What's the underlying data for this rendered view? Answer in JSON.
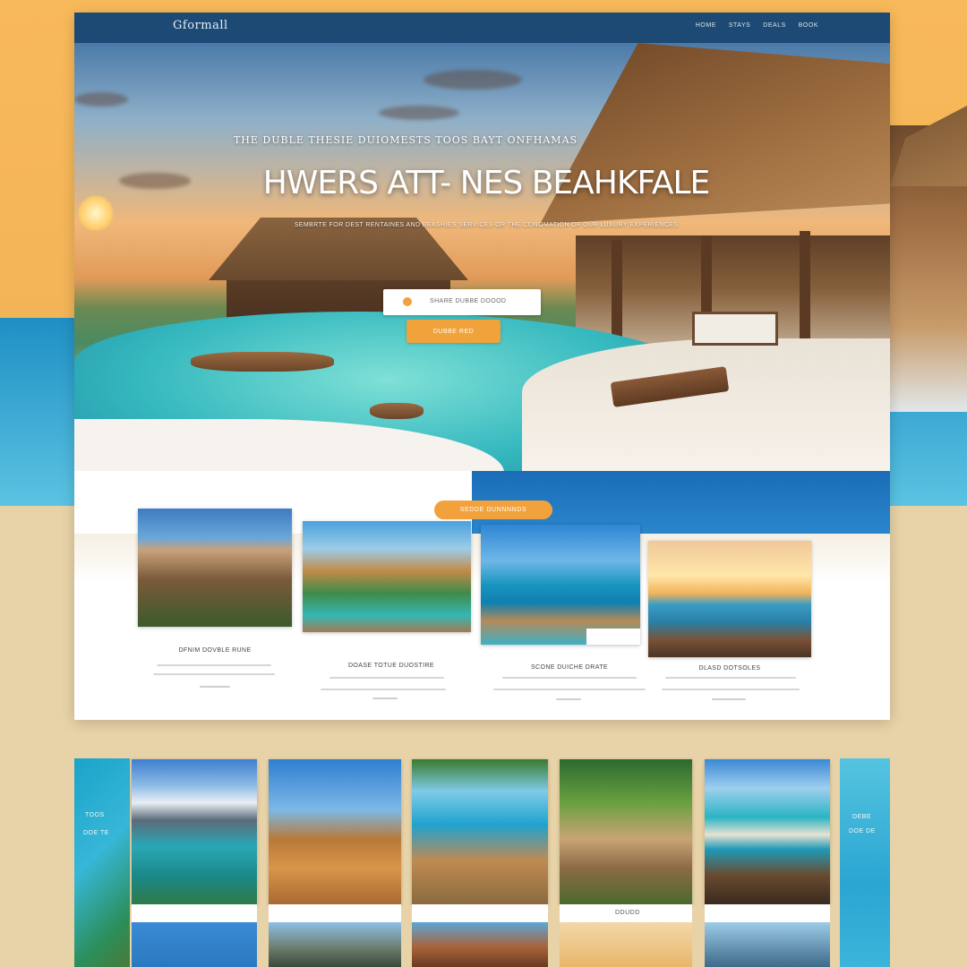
{
  "header": {
    "logo": "Gformall",
    "nav": [
      "HOME",
      "STAYS",
      "DEALS",
      "BOOK"
    ]
  },
  "hero": {
    "kicker": "THE DUBLE THESIE DUIOMESTS TOOS  BAYT ONFHAMAS",
    "title": "HWERS ATT- NES BEAHKFALE",
    "subtitle": "SEMBRTE FOR DEST RENTAINES AND BEASHIES SERVICES OR THE CONOMATION OF OUR LUXURY EXPERIENCES",
    "search_placeholder": "SHARE DUBBE DOOOD",
    "cta_label": "DUBBE RED"
  },
  "featured": {
    "pill_label": "SEDDE  DUNNNNDS",
    "cards": [
      {
        "title": "DFNIM DOVBLE RUNE"
      },
      {
        "title": "DOASE TOTUE DUOSTIRE"
      },
      {
        "title": "SCONE DUICHE DRATE"
      },
      {
        "title": "DLASD DOTSOLES"
      }
    ]
  },
  "gallery": {
    "left_label_1": "TOOS",
    "left_label_2": "DOE TE",
    "right_label_1": "DEBE",
    "right_label_2": "DOE DE",
    "caption": "DDUDD"
  },
  "colors": {
    "nav": "#1c4a74",
    "accent": "#f0a23b",
    "sea": "#1f8fc4",
    "sand": "#e8d2a7"
  }
}
